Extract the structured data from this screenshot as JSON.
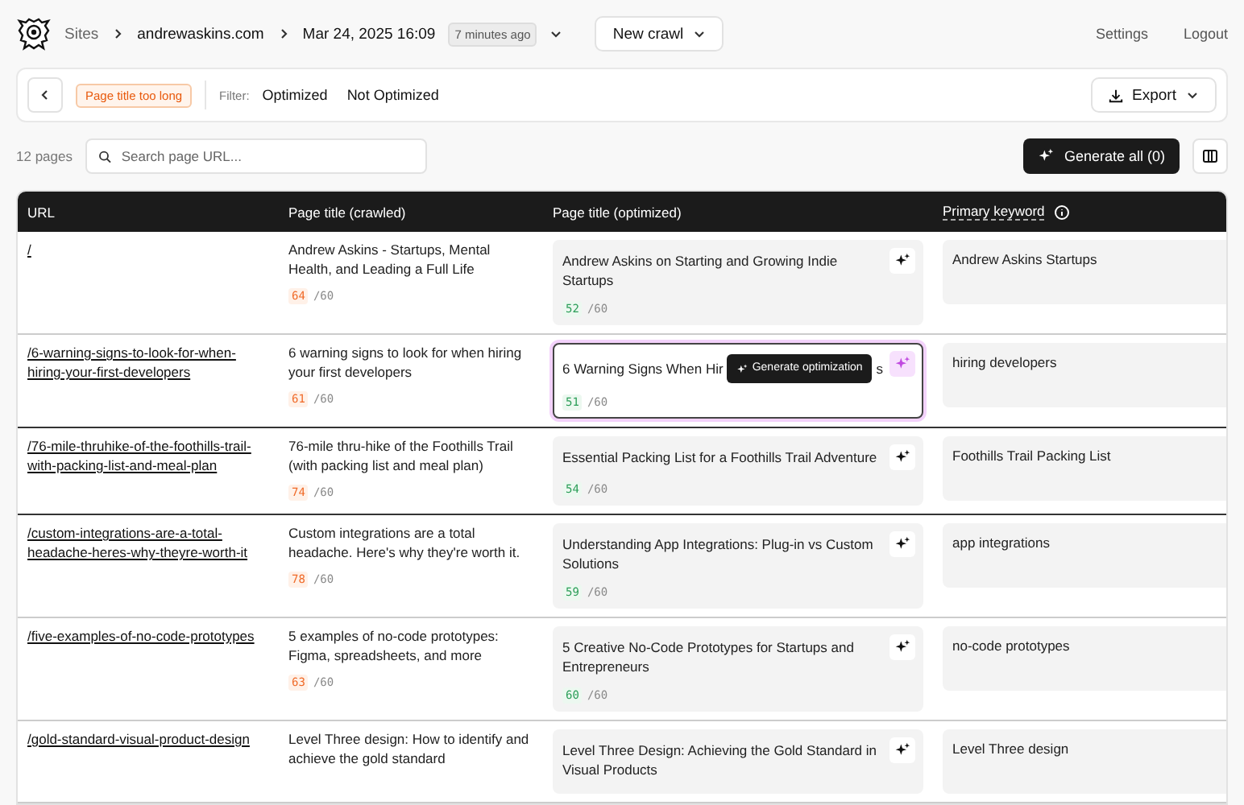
{
  "header": {
    "breadcrumbs": [
      "Sites",
      "andrewaskins.com",
      "Mar 24, 2025 16:09"
    ],
    "age_badge": "7 minutes ago",
    "new_crawl": "New crawl",
    "links": [
      "Settings",
      "Logout"
    ]
  },
  "toolbar": {
    "issue_tag": "Page title too long",
    "filter_label": "Filter:",
    "filters": [
      "Optimized",
      "Not Optimized"
    ],
    "export": "Export"
  },
  "controls": {
    "count": "12 pages",
    "search": {
      "placeholder": "Search page URL..."
    },
    "generate_all": "Generate all (0)"
  },
  "table": {
    "columns": [
      "URL",
      "Page title (crawled)",
      "Page title (optimized)",
      "Primary keyword"
    ],
    "rows": [
      {
        "url": "/",
        "crawled": "Andrew Askins - Startups, Mental Health, and Leading a Full Life",
        "crawled_count": "64",
        "crawled_limit": "/60",
        "crawled_over": true,
        "optimized": "Andrew Askins on Starting and Growing Indie Startups",
        "optimized_count": "52",
        "optimized_limit": "/60",
        "optimized_over": false,
        "focused": false,
        "keyword": "Andrew Askins Startups"
      },
      {
        "url": "/6-warning-signs-to-look-for-when-hiring-your-first-developers",
        "crawled": "6 warning signs to look for when hiring your first developers",
        "crawled_count": "61",
        "crawled_limit": "/60",
        "crawled_over": true,
        "optimized": "6 Warning Signs When Hir",
        "optimized_tail": "s",
        "tooltip": "Generate optimization",
        "optimized_count": "51",
        "optimized_limit": "/60",
        "optimized_over": false,
        "focused": true,
        "keyword": "hiring developers"
      },
      {
        "url": "/76-mile-thruhike-of-the-foothills-trail-with-packing-list-and-meal-plan",
        "crawled": "76-mile thru-hike of the Foothills Trail (with packing list and meal plan)",
        "crawled_count": "74",
        "crawled_limit": "/60",
        "crawled_over": true,
        "optimized": "Essential Packing List for a Foothills Trail Adventure",
        "optimized_count": "54",
        "optimized_limit": "/60",
        "optimized_over": false,
        "focused": false,
        "keyword": "Foothills Trail Packing List"
      },
      {
        "url": "/custom-integrations-are-a-total-headache-heres-why-theyre-worth-it",
        "crawled": "Custom integrations are a total headache. Here's why they're worth it.",
        "crawled_count": "78",
        "crawled_limit": "/60",
        "crawled_over": true,
        "optimized": "Understanding App Integrations: Plug-in vs Custom Solutions",
        "optimized_count": "59",
        "optimized_limit": "/60",
        "optimized_over": false,
        "focused": false,
        "keyword": "app integrations"
      },
      {
        "url": "/five-examples-of-no-code-prototypes",
        "crawled": "5 examples of no-code prototypes: Figma, spreadsheets, and more",
        "crawled_count": "63",
        "crawled_limit": "/60",
        "crawled_over": true,
        "optimized": "5 Creative No-Code Prototypes for Startups and Entrepreneurs",
        "optimized_count": "60",
        "optimized_limit": "/60",
        "optimized_over": false,
        "focused": false,
        "keyword": "no-code prototypes"
      },
      {
        "url": "/gold-standard-visual-product-design",
        "crawled": "Level Three design: How to identify and achieve the gold standard",
        "optimized": "Level Three Design: Achieving the Gold Standard in Visual Products",
        "focused": false,
        "keyword": "Level Three design"
      }
    ]
  }
}
